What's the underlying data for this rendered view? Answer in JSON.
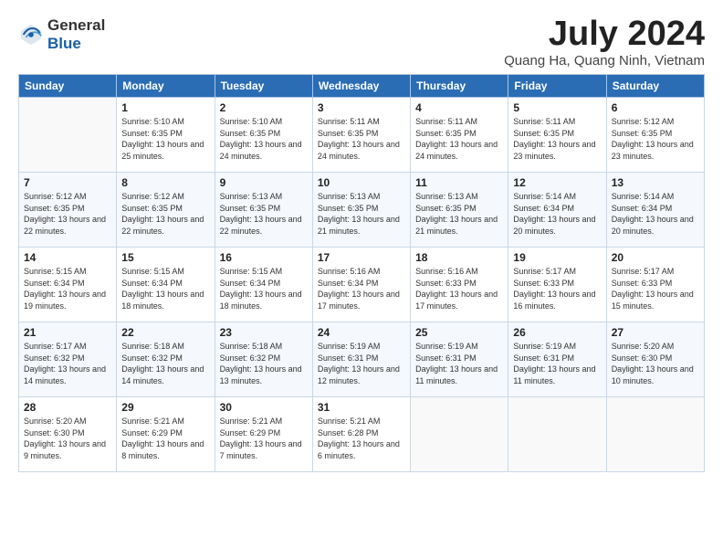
{
  "logo": {
    "general": "General",
    "blue": "Blue"
  },
  "title": {
    "month_year": "July 2024",
    "location": "Quang Ha, Quang Ninh, Vietnam"
  },
  "weekdays": [
    "Sunday",
    "Monday",
    "Tuesday",
    "Wednesday",
    "Thursday",
    "Friday",
    "Saturday"
  ],
  "weeks": [
    [
      {
        "day": "",
        "sunrise": "",
        "sunset": "",
        "daylight": ""
      },
      {
        "day": "1",
        "sunrise": "Sunrise: 5:10 AM",
        "sunset": "Sunset: 6:35 PM",
        "daylight": "Daylight: 13 hours and 25 minutes."
      },
      {
        "day": "2",
        "sunrise": "Sunrise: 5:10 AM",
        "sunset": "Sunset: 6:35 PM",
        "daylight": "Daylight: 13 hours and 24 minutes."
      },
      {
        "day": "3",
        "sunrise": "Sunrise: 5:11 AM",
        "sunset": "Sunset: 6:35 PM",
        "daylight": "Daylight: 13 hours and 24 minutes."
      },
      {
        "day": "4",
        "sunrise": "Sunrise: 5:11 AM",
        "sunset": "Sunset: 6:35 PM",
        "daylight": "Daylight: 13 hours and 24 minutes."
      },
      {
        "day": "5",
        "sunrise": "Sunrise: 5:11 AM",
        "sunset": "Sunset: 6:35 PM",
        "daylight": "Daylight: 13 hours and 23 minutes."
      },
      {
        "day": "6",
        "sunrise": "Sunrise: 5:12 AM",
        "sunset": "Sunset: 6:35 PM",
        "daylight": "Daylight: 13 hours and 23 minutes."
      }
    ],
    [
      {
        "day": "7",
        "sunrise": "Sunrise: 5:12 AM",
        "sunset": "Sunset: 6:35 PM",
        "daylight": "Daylight: 13 hours and 22 minutes."
      },
      {
        "day": "8",
        "sunrise": "Sunrise: 5:12 AM",
        "sunset": "Sunset: 6:35 PM",
        "daylight": "Daylight: 13 hours and 22 minutes."
      },
      {
        "day": "9",
        "sunrise": "Sunrise: 5:13 AM",
        "sunset": "Sunset: 6:35 PM",
        "daylight": "Daylight: 13 hours and 22 minutes."
      },
      {
        "day": "10",
        "sunrise": "Sunrise: 5:13 AM",
        "sunset": "Sunset: 6:35 PM",
        "daylight": "Daylight: 13 hours and 21 minutes."
      },
      {
        "day": "11",
        "sunrise": "Sunrise: 5:13 AM",
        "sunset": "Sunset: 6:35 PM",
        "daylight": "Daylight: 13 hours and 21 minutes."
      },
      {
        "day": "12",
        "sunrise": "Sunrise: 5:14 AM",
        "sunset": "Sunset: 6:34 PM",
        "daylight": "Daylight: 13 hours and 20 minutes."
      },
      {
        "day": "13",
        "sunrise": "Sunrise: 5:14 AM",
        "sunset": "Sunset: 6:34 PM",
        "daylight": "Daylight: 13 hours and 20 minutes."
      }
    ],
    [
      {
        "day": "14",
        "sunrise": "Sunrise: 5:15 AM",
        "sunset": "Sunset: 6:34 PM",
        "daylight": "Daylight: 13 hours and 19 minutes."
      },
      {
        "day": "15",
        "sunrise": "Sunrise: 5:15 AM",
        "sunset": "Sunset: 6:34 PM",
        "daylight": "Daylight: 13 hours and 18 minutes."
      },
      {
        "day": "16",
        "sunrise": "Sunrise: 5:15 AM",
        "sunset": "Sunset: 6:34 PM",
        "daylight": "Daylight: 13 hours and 18 minutes."
      },
      {
        "day": "17",
        "sunrise": "Sunrise: 5:16 AM",
        "sunset": "Sunset: 6:34 PM",
        "daylight": "Daylight: 13 hours and 17 minutes."
      },
      {
        "day": "18",
        "sunrise": "Sunrise: 5:16 AM",
        "sunset": "Sunset: 6:33 PM",
        "daylight": "Daylight: 13 hours and 17 minutes."
      },
      {
        "day": "19",
        "sunrise": "Sunrise: 5:17 AM",
        "sunset": "Sunset: 6:33 PM",
        "daylight": "Daylight: 13 hours and 16 minutes."
      },
      {
        "day": "20",
        "sunrise": "Sunrise: 5:17 AM",
        "sunset": "Sunset: 6:33 PM",
        "daylight": "Daylight: 13 hours and 15 minutes."
      }
    ],
    [
      {
        "day": "21",
        "sunrise": "Sunrise: 5:17 AM",
        "sunset": "Sunset: 6:32 PM",
        "daylight": "Daylight: 13 hours and 14 minutes."
      },
      {
        "day": "22",
        "sunrise": "Sunrise: 5:18 AM",
        "sunset": "Sunset: 6:32 PM",
        "daylight": "Daylight: 13 hours and 14 minutes."
      },
      {
        "day": "23",
        "sunrise": "Sunrise: 5:18 AM",
        "sunset": "Sunset: 6:32 PM",
        "daylight": "Daylight: 13 hours and 13 minutes."
      },
      {
        "day": "24",
        "sunrise": "Sunrise: 5:19 AM",
        "sunset": "Sunset: 6:31 PM",
        "daylight": "Daylight: 13 hours and 12 minutes."
      },
      {
        "day": "25",
        "sunrise": "Sunrise: 5:19 AM",
        "sunset": "Sunset: 6:31 PM",
        "daylight": "Daylight: 13 hours and 11 minutes."
      },
      {
        "day": "26",
        "sunrise": "Sunrise: 5:19 AM",
        "sunset": "Sunset: 6:31 PM",
        "daylight": "Daylight: 13 hours and 11 minutes."
      },
      {
        "day": "27",
        "sunrise": "Sunrise: 5:20 AM",
        "sunset": "Sunset: 6:30 PM",
        "daylight": "Daylight: 13 hours and 10 minutes."
      }
    ],
    [
      {
        "day": "28",
        "sunrise": "Sunrise: 5:20 AM",
        "sunset": "Sunset: 6:30 PM",
        "daylight": "Daylight: 13 hours and 9 minutes."
      },
      {
        "day": "29",
        "sunrise": "Sunrise: 5:21 AM",
        "sunset": "Sunset: 6:29 PM",
        "daylight": "Daylight: 13 hours and 8 minutes."
      },
      {
        "day": "30",
        "sunrise": "Sunrise: 5:21 AM",
        "sunset": "Sunset: 6:29 PM",
        "daylight": "Daylight: 13 hours and 7 minutes."
      },
      {
        "day": "31",
        "sunrise": "Sunrise: 5:21 AM",
        "sunset": "Sunset: 6:28 PM",
        "daylight": "Daylight: 13 hours and 6 minutes."
      },
      {
        "day": "",
        "sunrise": "",
        "sunset": "",
        "daylight": ""
      },
      {
        "day": "",
        "sunrise": "",
        "sunset": "",
        "daylight": ""
      },
      {
        "day": "",
        "sunrise": "",
        "sunset": "",
        "daylight": ""
      }
    ]
  ]
}
